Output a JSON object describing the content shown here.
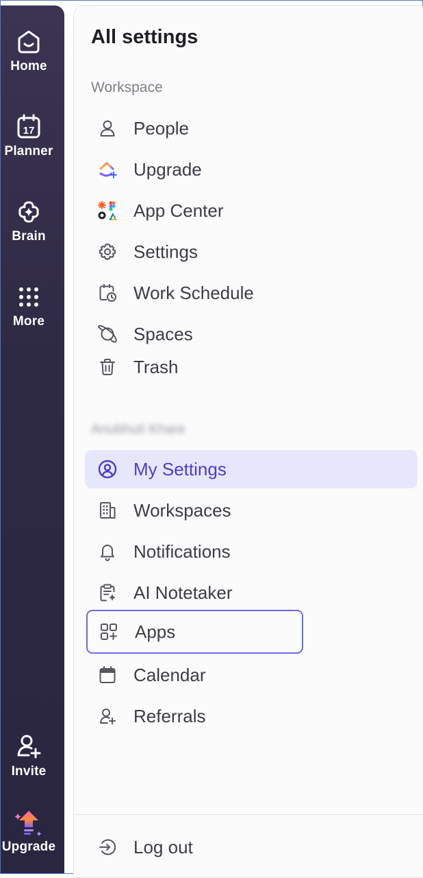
{
  "rail": {
    "home": "Home",
    "planner": "Planner",
    "planner_date": "17",
    "brain": "Brain",
    "more": "More",
    "invite": "Invite",
    "upgrade": "Upgrade"
  },
  "panel": {
    "title": "All settings",
    "workspace_section": "Workspace",
    "workspace_items": [
      {
        "label": "People",
        "icon": "person-icon"
      },
      {
        "label": "Upgrade",
        "icon": "clickup-upgrade-icon"
      },
      {
        "label": "App Center",
        "icon": "app-center-icon"
      },
      {
        "label": "Settings",
        "icon": "gear-icon"
      },
      {
        "label": "Work Schedule",
        "icon": "calendar-clock-icon"
      },
      {
        "label": "Spaces",
        "icon": "planet-icon"
      },
      {
        "label": "Trash",
        "icon": "trash-icon"
      }
    ],
    "user_section": "Anubhuti Khare",
    "user_items": [
      {
        "label": "My Settings",
        "icon": "user-circle-icon"
      },
      {
        "label": "Workspaces",
        "icon": "building-icon"
      },
      {
        "label": "Notifications",
        "icon": "bell-icon"
      },
      {
        "label": "AI Notetaker",
        "icon": "clipboard-sparkle-icon"
      },
      {
        "label": "Apps",
        "icon": "apps-plus-icon"
      },
      {
        "label": "Calendar",
        "icon": "calendar-icon"
      },
      {
        "label": "Referrals",
        "icon": "person-plus-icon"
      }
    ],
    "logout": "Log out"
  },
  "colors": {
    "rail_bg": "#2f2a44",
    "active_bg": "#e6e7fb",
    "active_text": "#4b3fcf",
    "focus_ring": "#6d67ea"
  }
}
